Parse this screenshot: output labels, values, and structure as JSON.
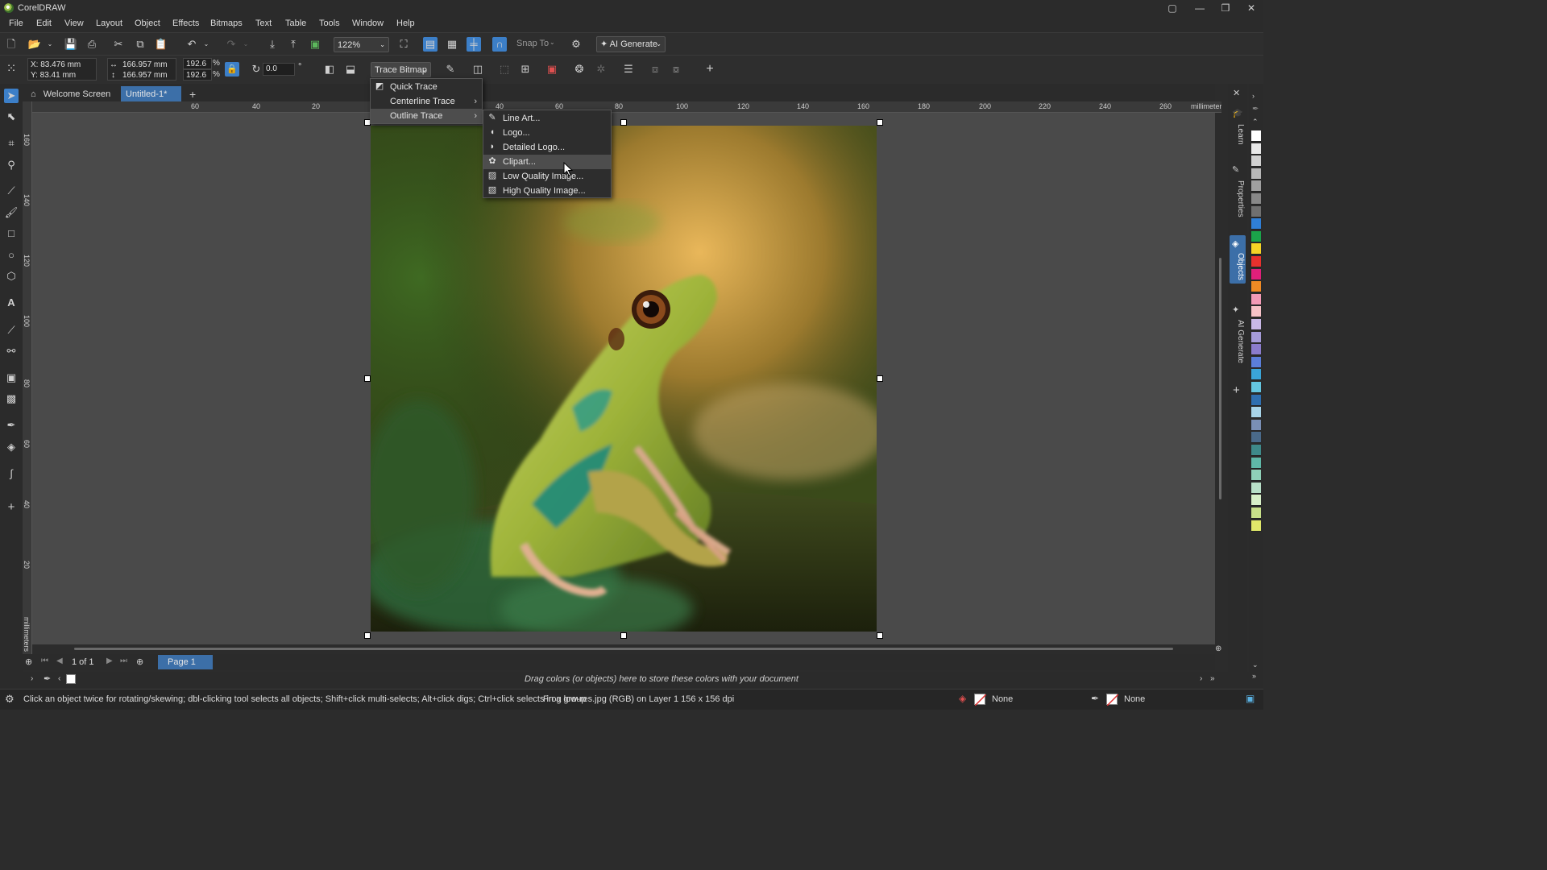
{
  "app": {
    "title": "CorelDRAW"
  },
  "menubar": [
    "File",
    "Edit",
    "View",
    "Layout",
    "Object",
    "Effects",
    "Bitmaps",
    "Text",
    "Table",
    "Tools",
    "Window",
    "Help"
  ],
  "toolbar1": {
    "zoom": "122%",
    "snap_to": "Snap To",
    "ai_generate": "AI Generate"
  },
  "toolbar2": {
    "x": "X: 83.476 mm",
    "y": "Y: 83.41 mm",
    "width": "166.957 mm",
    "height": "166.957 mm",
    "scale_w": "192.6",
    "scale_h": "192.6",
    "pct": "%",
    "rotation": "0.0",
    "degree": "°",
    "trace_bitmap": "Trace Bitmap"
  },
  "doc_tabs": {
    "welcome": "Welcome Screen",
    "untitled": "Untitled-1*"
  },
  "ruler": {
    "h_labels": [
      "60",
      "40",
      "20",
      "40",
      "60",
      "80",
      "100",
      "120",
      "140",
      "160",
      "180",
      "200",
      "220",
      "240",
      "260"
    ],
    "units": "millimeters",
    "v_labels": [
      "160",
      "140",
      "120",
      "100",
      "80",
      "60",
      "40",
      "20"
    ],
    "v_units": "millimeters"
  },
  "trace_menu": {
    "items": [
      "Quick Trace",
      "Centerline Trace",
      "Outline Trace"
    ]
  },
  "outline_submenu": {
    "items": [
      "Line Art...",
      "Logo...",
      "Detailed Logo...",
      "Clipart...",
      "Low Quality Image...",
      "High Quality Image..."
    ]
  },
  "pagebar": {
    "counter": "1 of 1",
    "page": "Page 1"
  },
  "palette_hint": "Drag colors (or objects) here to store these colors with your document",
  "status": {
    "hint": "Click an object twice for rotating/skewing; dbl-clicking tool selects all objects; Shift+click multi-selects; Alt+click digs; Ctrl+click selects in a group",
    "object_info": "Frog low-res.jpg (RGB) on Layer 1  156 x 156 dpi",
    "fill": "None",
    "outline": "None"
  },
  "dockers": [
    "Learn",
    "Properties",
    "Objects",
    "AI Generate"
  ],
  "palette_colors": [
    "#ffffff",
    "#e8e8e8",
    "#d0d0d0",
    "#b8b8b8",
    "#a0a0a0",
    "#888888",
    "#707070",
    "#2f7fd6",
    "#1ba34a",
    "#f5d426",
    "#e8312d",
    "#e01f7a",
    "#f08a24",
    "#f39ab6",
    "#f7c2c7",
    "#c9b8e6",
    "#a59bd8",
    "#8b7ccc",
    "#5b7ed9",
    "#3aa5d8",
    "#64c6e0",
    "#2f6fb0",
    "#a8d5ea",
    "#7a8fb5",
    "#4a6a8a",
    "#3e8a8a",
    "#5fb8a8",
    "#8fd0b8",
    "#b8e0c8",
    "#d8f0c8",
    "#c8e08a",
    "#e0e86a"
  ]
}
